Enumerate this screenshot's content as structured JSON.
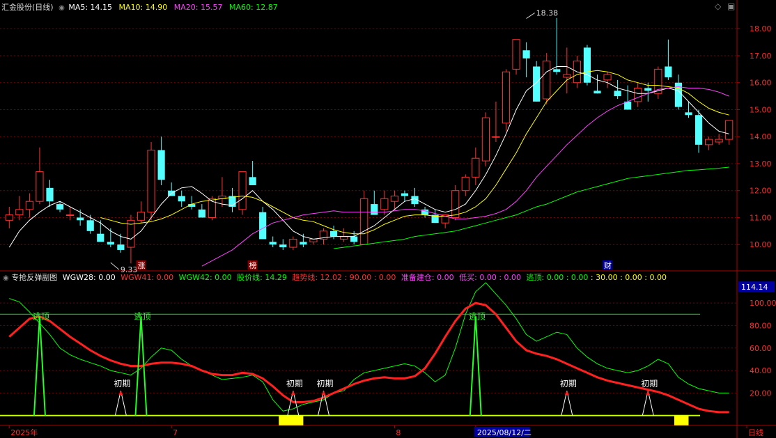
{
  "header": {
    "stock_name": "汇金股份(日线)",
    "ma": [
      {
        "label": "MA5: 14.15",
        "color": "#ffffff"
      },
      {
        "label": "MA10: 14.90",
        "color": "#ffff00"
      },
      {
        "label": "MA20: 15.57",
        "color": "#ff40ff"
      },
      {
        "label": "MA60: 12.87",
        "color": "#00ff00"
      }
    ]
  },
  "indicator_header": {
    "name": "专抢反弹副图",
    "items": [
      {
        "label": "WGW28: 0.00",
        "color": "#ffffff"
      },
      {
        "label": "WGW41: 0.00",
        "color": "#ff3030"
      },
      {
        "label": "WGW42: 0.00",
        "color": "#00ff00"
      },
      {
        "label": "股价线: 14.29",
        "color": "#00ff00"
      },
      {
        "label": "趋势线: 12.02 : 90.00 : 0.00",
        "color": "#ff3030"
      },
      {
        "label": "准备建仓: 0.00",
        "color": "#ff40ff"
      },
      {
        "label": "低买: 0.00 : 0.00",
        "color": "#ff40ff"
      },
      {
        "label": "逃顶: 0.00 : 0.00",
        "color": "#00ff00"
      },
      {
        "label": ": 30.00 : 0.00 : 0.00",
        "color": "#ffff00"
      }
    ]
  },
  "colors": {
    "up": "#ff3232",
    "down": "#54ffff",
    "grid": "#7a0000",
    "axis": "#b00000"
  },
  "chart_data": [
    {
      "type": "candlestick",
      "y_ticks": [
        "10.00",
        "11.00",
        "12.00",
        "13.00",
        "14.00",
        "15.00",
        "16.00",
        "17.00",
        "18.00"
      ],
      "ylim": [
        9.05,
        18.6
      ],
      "annotations": [
        {
          "text": "18.38",
          "index": 51,
          "value": 18.38
        },
        {
          "text": "9.33",
          "index": 10,
          "value": 9.33
        }
      ],
      "event_labels": [
        {
          "text": "涨",
          "index": 13
        },
        {
          "text": "榜",
          "index": 24
        },
        {
          "text": "财",
          "index": 59
        }
      ],
      "candles": [
        [
          10.9,
          11.4,
          10.6,
          11.1
        ],
        [
          11.1,
          11.8,
          10.9,
          11.3
        ],
        [
          11.3,
          11.9,
          11.0,
          11.6
        ],
        [
          11.6,
          13.6,
          11.5,
          12.7
        ],
        [
          12.1,
          12.4,
          11.4,
          11.6
        ],
        [
          11.5,
          11.6,
          11.2,
          11.3
        ],
        [
          11.1,
          11.4,
          10.9,
          11.1
        ],
        [
          11.0,
          11.3,
          10.7,
          10.9
        ],
        [
          10.9,
          11.1,
          10.4,
          10.5
        ],
        [
          10.4,
          10.9,
          10.2,
          10.1
        ],
        [
          10.1,
          10.6,
          9.9,
          10.0
        ],
        [
          10.0,
          10.4,
          9.7,
          9.8
        ],
        [
          9.9,
          11.1,
          9.3,
          10.9
        ],
        [
          10.9,
          11.6,
          10.8,
          11.2
        ],
        [
          11.2,
          13.8,
          10.9,
          13.5
        ],
        [
          13.5,
          14.0,
          12.2,
          12.4
        ],
        [
          12.0,
          12.3,
          11.8,
          11.8
        ],
        [
          11.8,
          12.0,
          11.4,
          11.6
        ],
        [
          11.5,
          11.8,
          11.3,
          11.4
        ],
        [
          11.3,
          11.5,
          11.0,
          11.0
        ],
        [
          11.0,
          11.8,
          10.9,
          11.7
        ],
        [
          11.7,
          12.5,
          11.4,
          11.8
        ],
        [
          11.8,
          12.1,
          11.2,
          11.4
        ],
        [
          11.3,
          12.7,
          11.1,
          12.7
        ],
        [
          12.5,
          13.1,
          12.2,
          12.2
        ],
        [
          11.2,
          11.4,
          10.2,
          10.2
        ],
        [
          10.1,
          10.3,
          9.9,
          10.0
        ],
        [
          10.0,
          10.2,
          9.8,
          9.9
        ],
        [
          9.9,
          10.3,
          9.8,
          10.2
        ],
        [
          10.1,
          10.4,
          9.9,
          10.0
        ],
        [
          10.1,
          10.2,
          10.0,
          10.2
        ],
        [
          10.2,
          10.6,
          10.0,
          10.5
        ],
        [
          10.5,
          10.7,
          10.2,
          10.3
        ],
        [
          10.2,
          10.6,
          10.1,
          10.3
        ],
        [
          10.3,
          10.5,
          10.0,
          10.1
        ],
        [
          10.0,
          12.0,
          10.0,
          11.7
        ],
        [
          11.5,
          12.0,
          11.3,
          11.1
        ],
        [
          11.3,
          12.0,
          11.1,
          11.7
        ],
        [
          11.6,
          12.0,
          11.3,
          11.8
        ],
        [
          11.9,
          12.0,
          11.6,
          11.8
        ],
        [
          11.8,
          12.1,
          11.4,
          11.5
        ],
        [
          11.3,
          11.4,
          11.0,
          11.1
        ],
        [
          11.1,
          11.3,
          10.8,
          10.8
        ],
        [
          10.8,
          11.1,
          10.6,
          11.1
        ],
        [
          11.0,
          12.2,
          10.9,
          12.0
        ],
        [
          12.0,
          12.6,
          11.8,
          12.5
        ],
        [
          12.5,
          13.6,
          12.2,
          13.2
        ],
        [
          13.1,
          14.9,
          12.9,
          14.7
        ],
        [
          14.0,
          15.3,
          13.8,
          14.0
        ],
        [
          14.5,
          16.5,
          14.2,
          16.4
        ],
        [
          16.5,
          17.5,
          16.3,
          17.6
        ],
        [
          17.2,
          17.5,
          16.2,
          16.9
        ],
        [
          16.6,
          16.8,
          15.3,
          15.3
        ],
        [
          15.4,
          17.1,
          15.2,
          16.8
        ],
        [
          16.5,
          18.4,
          16.3,
          16.4
        ],
        [
          16.2,
          17.3,
          15.6,
          16.3
        ],
        [
          16.0,
          17.0,
          15.8,
          16.8
        ],
        [
          17.3,
          17.4,
          15.9,
          16.0
        ],
        [
          15.7,
          16.3,
          15.6,
          15.6
        ],
        [
          16.1,
          16.4,
          15.8,
          16.3
        ],
        [
          15.7,
          16.1,
          15.4,
          15.5
        ],
        [
          15.3,
          15.9,
          15.1,
          15.0
        ],
        [
          15.3,
          16.0,
          15.1,
          15.8
        ],
        [
          15.8,
          16.0,
          15.3,
          15.7
        ],
        [
          15.6,
          16.6,
          15.4,
          16.5
        ],
        [
          16.6,
          17.6,
          16.1,
          16.2
        ],
        [
          16.0,
          16.3,
          15.0,
          15.1
        ],
        [
          14.9,
          15.3,
          14.7,
          14.8
        ],
        [
          14.8,
          15.0,
          13.4,
          13.7
        ],
        [
          13.7,
          14.0,
          13.5,
          13.9
        ],
        [
          13.8,
          14.1,
          13.7,
          13.9
        ],
        [
          13.9,
          14.6,
          13.7,
          14.6
        ]
      ],
      "series": [
        {
          "name": "MA5",
          "color": "#ffffff",
          "values": [
            9.9,
            10.5,
            10.9,
            11.2,
            11.45,
            11.6,
            11.4,
            11.2,
            11.0,
            10.8,
            10.5,
            10.3,
            10.2,
            10.5,
            11.0,
            11.5,
            11.9,
            12.1,
            12.15,
            11.9,
            11.6,
            11.5,
            11.45,
            11.7,
            12.0,
            11.6,
            11.3,
            10.9,
            10.5,
            10.3,
            10.2,
            10.25,
            10.3,
            10.3,
            10.3,
            10.5,
            10.7,
            11.0,
            11.3,
            11.6,
            11.7,
            11.5,
            11.3,
            11.2,
            11.3,
            11.5,
            12.0,
            12.6,
            13.3,
            14.1,
            15.0,
            15.7,
            16.0,
            16.4,
            16.6,
            16.6,
            16.4,
            16.3,
            16.1,
            16.0,
            15.8,
            15.7,
            15.6,
            15.6,
            15.7,
            15.8,
            15.7,
            15.3,
            14.9,
            14.5,
            14.2,
            14.1
          ]
        },
        {
          "name": "MA10",
          "color": "#ffff00",
          "values": [
            null,
            null,
            null,
            null,
            null,
            null,
            null,
            null,
            null,
            11.0,
            10.9,
            10.8,
            10.75,
            10.8,
            10.85,
            10.95,
            11.1,
            11.3,
            11.5,
            11.6,
            11.65,
            11.7,
            11.75,
            11.8,
            11.75,
            11.6,
            11.4,
            11.2,
            11.0,
            10.9,
            10.85,
            10.7,
            10.55,
            10.45,
            10.4,
            10.4,
            10.55,
            10.75,
            10.9,
            11.05,
            11.1,
            11.1,
            11.05,
            11.05,
            11.1,
            11.2,
            11.4,
            11.7,
            12.2,
            12.8,
            13.4,
            14.1,
            14.7,
            15.3,
            15.7,
            16.1,
            16.3,
            16.4,
            16.45,
            16.4,
            16.3,
            16.1,
            16.0,
            15.9,
            15.9,
            15.85,
            15.8,
            15.6,
            15.3,
            15.05,
            14.9,
            14.8
          ]
        },
        {
          "name": "MA20",
          "color": "#ff40ff",
          "values": [
            null,
            null,
            null,
            null,
            null,
            null,
            null,
            null,
            null,
            null,
            null,
            null,
            null,
            null,
            null,
            null,
            null,
            null,
            null,
            9.2,
            9.4,
            9.6,
            9.8,
            10.1,
            10.4,
            10.6,
            10.8,
            10.9,
            11.0,
            11.1,
            11.15,
            11.2,
            11.25,
            11.2,
            11.2,
            11.2,
            11.2,
            11.2,
            11.25,
            11.3,
            11.3,
            11.25,
            11.15,
            11.05,
            10.95,
            10.95,
            11.0,
            11.05,
            11.15,
            11.3,
            11.6,
            12.0,
            12.5,
            12.9,
            13.3,
            13.7,
            14.05,
            14.4,
            14.7,
            14.95,
            15.15,
            15.3,
            15.45,
            15.6,
            15.75,
            15.8,
            15.85,
            15.8,
            15.8,
            15.75,
            15.65,
            15.5
          ]
        },
        {
          "name": "MA60",
          "color": "#00ff00",
          "values": [
            null,
            null,
            null,
            null,
            null,
            null,
            null,
            null,
            null,
            null,
            null,
            null,
            null,
            null,
            null,
            null,
            null,
            null,
            null,
            null,
            null,
            null,
            null,
            null,
            null,
            null,
            null,
            null,
            null,
            null,
            null,
            null,
            9.85,
            9.9,
            9.95,
            10.0,
            10.05,
            10.1,
            10.15,
            10.2,
            10.3,
            10.35,
            10.4,
            10.45,
            10.5,
            10.6,
            10.7,
            10.8,
            10.9,
            11.0,
            11.1,
            11.25,
            11.4,
            11.5,
            11.65,
            11.8,
            11.95,
            12.05,
            12.15,
            12.25,
            12.35,
            12.45,
            12.5,
            12.55,
            12.6,
            12.65,
            12.7,
            12.75,
            12.77,
            12.8,
            12.83,
            12.87
          ]
        }
      ]
    },
    {
      "type": "line",
      "y_ticks": [
        "20.00",
        "40.00",
        "60.00",
        "80.00",
        "100.00"
      ],
      "ylim": [
        -2,
        118
      ],
      "last_value_label": "114.14",
      "reference_line": 90,
      "series": [
        {
          "name": "股价线",
          "color": "#00ff00",
          "values": [
            104,
            101,
            92,
            82,
            72,
            60,
            54,
            50,
            47,
            44,
            40,
            38,
            36,
            42,
            52,
            60,
            58,
            50,
            44,
            40,
            36,
            32,
            33,
            34,
            36,
            30,
            14,
            4,
            6,
            10,
            12,
            14,
            20,
            22,
            32,
            38,
            40,
            42,
            44,
            46,
            44,
            38,
            30,
            36,
            60,
            90,
            110,
            118,
            108,
            98,
            86,
            72,
            66,
            70,
            74,
            72,
            60,
            52,
            46,
            42,
            40,
            38,
            40,
            44,
            50,
            46,
            34,
            28,
            24,
            22,
            20,
            20
          ]
        },
        {
          "name": "趋势线",
          "color": "#ff2020",
          "values": [
            70,
            78,
            86,
            88,
            84,
            77,
            70,
            64,
            58,
            53,
            49,
            46,
            44,
            44,
            46,
            47,
            47,
            46,
            44,
            40,
            37,
            36,
            36,
            38,
            37,
            33,
            26,
            18,
            12,
            12,
            13,
            16,
            20,
            24,
            28,
            31,
            33,
            34,
            33,
            33,
            35,
            42,
            55,
            70,
            84,
            95,
            100,
            98,
            90,
            78,
            66,
            58,
            55,
            53,
            50,
            46,
            42,
            38,
            34,
            31,
            29,
            27,
            25,
            23,
            21,
            18,
            14,
            10,
            6,
            4,
            3,
            3
          ]
        }
      ],
      "labels": [
        {
          "text": "逃顶",
          "index": 3
        },
        {
          "text": "逃顶",
          "index": 13
        },
        {
          "text": "初期",
          "index": 11
        },
        {
          "text": "初期",
          "index": 28
        },
        {
          "text": "初期",
          "index": 31
        },
        {
          "text": "逃顶",
          "index": 46
        },
        {
          "text": "初期",
          "index": 55
        },
        {
          "text": "初期",
          "index": 63
        }
      ],
      "x_ticks": [
        {
          "text": "2025年",
          "index": 0
        },
        {
          "text": "7",
          "index": 16
        },
        {
          "text": "8",
          "index": 38
        },
        {
          "text": "2025/08/12/二",
          "index": 46
        },
        {
          "text": "日线",
          "index": 70
        }
      ]
    }
  ]
}
